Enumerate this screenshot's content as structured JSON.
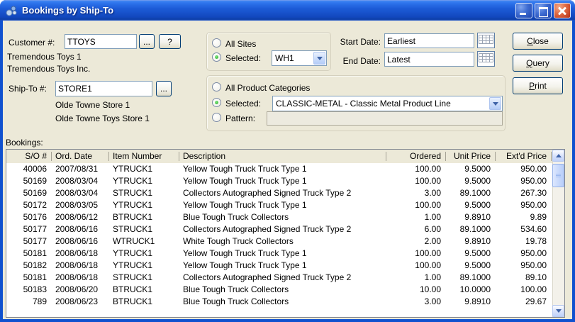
{
  "window": {
    "title": "Bookings by Ship-To"
  },
  "customer": {
    "label": "Customer #:",
    "value": "TTOYS",
    "browse_label": "...",
    "help_label": "?",
    "name_line1": "Tremendous Toys 1",
    "name_line2": "Tremendous Toys Inc."
  },
  "ship_to": {
    "label": "Ship-To #:",
    "value": "STORE1",
    "browse_label": "...",
    "name_line1": "Olde Towne Store 1",
    "name_line2": "Olde Towne Toys Store 1"
  },
  "sites": {
    "all_label": "All Sites",
    "selected_label": "Selected:",
    "selected_value": "WH1"
  },
  "dates": {
    "start_label": "Start Date:",
    "start_value": "Earliest",
    "end_label": "End Date:",
    "end_value": "Latest"
  },
  "actions": {
    "close": "Close",
    "query": "Query",
    "print": "Print"
  },
  "product_categories": {
    "all_label": "All Product Categories",
    "selected_label": "Selected:",
    "selected_value": "CLASSIC-METAL - Classic Metal Product Line",
    "pattern_label": "Pattern:",
    "pattern_value": ""
  },
  "bookings": {
    "label": "Bookings:",
    "columns": [
      "S/O #",
      "Ord. Date",
      "Item Number",
      "Description",
      "Ordered",
      "Unit Price",
      "Ext'd Price"
    ],
    "rows": [
      [
        "40006",
        "2007/08/31",
        "YTRUCK1",
        "Yellow Tough Truck Truck Type 1",
        "100.00",
        "9.5000",
        "950.00"
      ],
      [
        "50169",
        "2008/03/04",
        "YTRUCK1",
        "Yellow Tough Truck Truck Type 1",
        "100.00",
        "9.5000",
        "950.00"
      ],
      [
        "50169",
        "2008/03/04",
        "STRUCK1",
        "Collectors Autographed Signed Truck Type 2",
        "3.00",
        "89.1000",
        "267.30"
      ],
      [
        "50172",
        "2008/03/05",
        "YTRUCK1",
        "Yellow Tough Truck Truck Type 1",
        "100.00",
        "9.5000",
        "950.00"
      ],
      [
        "50176",
        "2008/06/12",
        "BTRUCK1",
        "Blue Tough Truck Collectors",
        "1.00",
        "9.8910",
        "9.89"
      ],
      [
        "50177",
        "2008/06/16",
        "STRUCK1",
        "Collectors Autographed Signed Truck Type 2",
        "6.00",
        "89.1000",
        "534.60"
      ],
      [
        "50177",
        "2008/06/16",
        "WTRUCK1",
        "White Tough Truck Collectors",
        "2.00",
        "9.8910",
        "19.78"
      ],
      [
        "50181",
        "2008/06/18",
        "YTRUCK1",
        "Yellow Tough Truck Truck Type 1",
        "100.00",
        "9.5000",
        "950.00"
      ],
      [
        "50182",
        "2008/06/18",
        "YTRUCK1",
        "Yellow Tough Truck Truck Type 1",
        "100.00",
        "9.5000",
        "950.00"
      ],
      [
        "50181",
        "2008/06/18",
        "STRUCK1",
        "Collectors Autographed Signed Truck Type 2",
        "1.00",
        "89.1000",
        "89.10"
      ],
      [
        "50183",
        "2008/06/20",
        "BTRUCK1",
        "Blue Tough Truck Collectors",
        "10.00",
        "10.0000",
        "100.00"
      ],
      [
        "789",
        "2008/06/23",
        "BTRUCK1",
        "Blue Tough Truck Collectors",
        "3.00",
        "9.8910",
        "29.67"
      ]
    ]
  },
  "colors": {
    "titlebar_blue": "#1D5CD8",
    "window_border": "#1051CF",
    "dialog_background": "#ECE9D8",
    "close_button_red": "#C54227",
    "radio_selected_green": "#22A322",
    "input_border": "#7F9DB9"
  }
}
